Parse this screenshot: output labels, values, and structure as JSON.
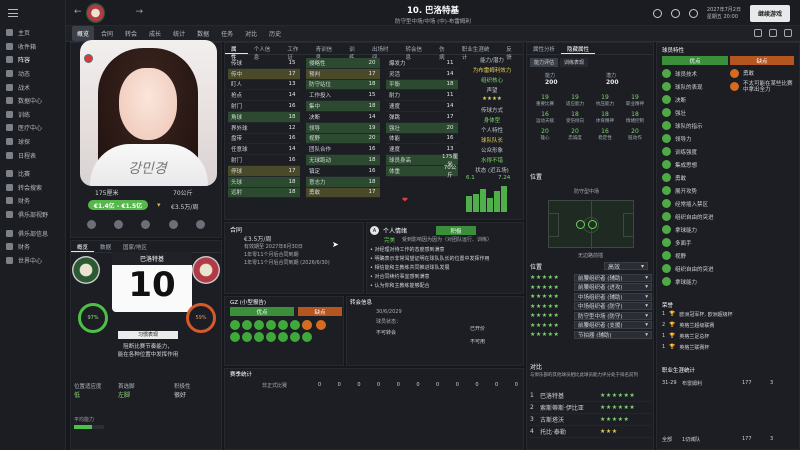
{
  "sidebar": {
    "items": [
      {
        "label": "主页",
        "active": false
      },
      {
        "label": "收件箱",
        "active": false
      },
      {
        "label": "阵容",
        "active": true
      },
      {
        "label": "动态",
        "active": false
      },
      {
        "label": "战术",
        "active": false
      },
      {
        "label": "数据中心",
        "active": false
      },
      {
        "label": "训练",
        "active": false
      },
      {
        "label": "医疗中心",
        "active": false
      },
      {
        "label": "球探",
        "active": false
      },
      {
        "label": "日程表",
        "active": false
      },
      {
        "label": "比赛",
        "active": false
      },
      {
        "label": "转会搜索",
        "active": false
      },
      {
        "label": "财务",
        "active": false
      },
      {
        "label": "俱乐部视野",
        "active": false
      },
      {
        "label": "俱乐部信息",
        "active": false
      },
      {
        "label": "财务",
        "active": false
      },
      {
        "label": "世界中心",
        "active": false
      }
    ]
  },
  "topbar": {
    "player_title": "10. 巴洛特基",
    "player_subtitle": "防守型中场/中场 (中)-布雷姆利",
    "nav": [
      "阵容",
      "合同",
      "球探",
      "发展",
      "数据",
      "训练",
      "对比",
      "历史"
    ],
    "date_line1": "2027年7月2日",
    "date_line2": "星期五 20:00",
    "continue_button": "继续游戏"
  },
  "tabs": [
    "概览",
    "合同",
    "转会",
    "成长",
    "统计",
    "数据",
    "任务",
    "对比",
    "历史"
  ],
  "profile": {
    "height": "175厘米",
    "weight": "70公斤",
    "value_range": "€1.4亿 - €1.5亿",
    "wage": "€3.5万/周",
    "photo_signature": "강민경"
  },
  "left_subtabs": [
    "概览",
    "数据",
    "国家/地区"
  ],
  "shirt": {
    "name": "巴洛特基",
    "number": "10"
  },
  "personality": {
    "label": "习惯表现",
    "desc_line1": "阻断比赛节奏能力，",
    "desc_line2": "能在各种位置中发挥作用",
    "stat_left": "97%",
    "stat_right": "59%"
  },
  "bottom_left": {
    "left_title": "位置适应度",
    "left_value": "低",
    "mid_title": "首选脚",
    "mid_value": "左脚",
    "right_title": "积极性",
    "right_value": "很好",
    "foot_note": "平均能力"
  },
  "attr_tabs": [
    "属性",
    "个人信息",
    "工作证",
    "青训信息",
    "训练",
    "出场时间",
    "转会信息",
    "伤病",
    "职业生涯统计",
    "反馈"
  ],
  "technical": {
    "title": "技术",
    "rows": [
      {
        "name": "传球",
        "value": "15"
      },
      {
        "name": "传中",
        "value": "17"
      },
      {
        "name": "盯人",
        "value": "13"
      },
      {
        "name": "抢点",
        "value": "14"
      },
      {
        "name": "射门",
        "value": "16"
      },
      {
        "name": "角球",
        "value": "18"
      },
      {
        "name": "界外球",
        "value": "12"
      },
      {
        "name": "盘带",
        "value": "16"
      },
      {
        "name": "任意球",
        "value": "14"
      },
      {
        "name": "射门",
        "value": "16"
      },
      {
        "name": "停球",
        "value": "17"
      },
      {
        "name": "头球",
        "value": "18"
      },
      {
        "name": "远射",
        "value": "18"
      }
    ]
  },
  "mental": {
    "title": "精神",
    "rows": [
      {
        "name": "侵略性",
        "value": "20"
      },
      {
        "name": "预判",
        "value": "17"
      },
      {
        "name": "防守站位",
        "value": "18"
      },
      {
        "name": "工作投入",
        "value": "15"
      },
      {
        "name": "集中",
        "value": "18"
      },
      {
        "name": "决断",
        "value": "14"
      },
      {
        "name": "领导",
        "value": "19"
      },
      {
        "name": "视野",
        "value": "20"
      },
      {
        "name": "团队合作",
        "value": "16"
      },
      {
        "name": "无球跑动",
        "value": "18"
      },
      {
        "name": "镇定",
        "value": "16"
      },
      {
        "name": "意志力",
        "value": "18"
      },
      {
        "name": "勇敢",
        "value": "17"
      }
    ]
  },
  "physical": {
    "title": "身体",
    "rows": [
      {
        "name": "爆发力",
        "value": "11"
      },
      {
        "name": "灵活",
        "value": "14"
      },
      {
        "name": "平衡",
        "value": "18"
      },
      {
        "name": "耐力",
        "value": "11"
      },
      {
        "name": "速度",
        "value": "14"
      },
      {
        "name": "弹跳",
        "value": "17"
      },
      {
        "name": "强壮",
        "value": "20"
      },
      {
        "name": "体能",
        "value": "16"
      },
      {
        "name": "速度",
        "value": "13"
      },
      {
        "name": "球员身高",
        "value": "175厘米"
      },
      {
        "name": "体重",
        "value": "70公斤"
      }
    ]
  },
  "roles_panel": {
    "title": "能力/潜力",
    "items": [
      {
        "label": "为布雷姆利效力",
        "cls": "y"
      },
      {
        "label": "组织核心",
        "cls": "g"
      },
      {
        "label": "声望",
        "cls": ""
      },
      {
        "label": "★★★★",
        "cls": "y"
      },
      {
        "label": "传球方式",
        "cls": ""
      },
      {
        "label": "身体型",
        "cls": "g"
      },
      {
        "label": "个人特性",
        "cls": ""
      },
      {
        "label": "球队队长",
        "cls": "y"
      },
      {
        "label": "公众形象",
        "cls": ""
      },
      {
        "label": "水得不错",
        "cls": "g"
      },
      {
        "label": "状态 (近五场)",
        "cls": ""
      }
    ]
  },
  "form": {
    "values": [
      6.1,
      7.24
    ]
  },
  "mini_bars": [
    0.6,
    0.7,
    0.9,
    0.55,
    0.8,
    1.0
  ],
  "contract": {
    "title": "合同",
    "wage": "€3.5万/周",
    "line1": "有效期至 2027年6月30日",
    "line2": "1年零11个月后合同到期",
    "line3": "1年零11个月后合同到期 (2026/6/30)"
  },
  "report": {
    "title": "个人情绪",
    "tag": "完美",
    "sub": "受到影响因为因为（对团队运行、训练）",
    "status": "积极",
    "lines": [
      "对经理对待工作的态度感到满意",
      "明确表示非常渴望证明在球队队长的位置中发挥作用",
      "相信能和主教练共同推进球队发展",
      "对合同续约事宜感到满意",
      "认为你和主教练能够配合"
    ]
  },
  "gz": {
    "title": "GZ (小型报告)",
    "good": "优点",
    "bad": "缺点"
  },
  "match_info": {
    "title": "转会信息",
    "date": "30/6/2029",
    "status1": "球员状态：",
    "val1": "不可转会",
    "status2": "已开价",
    "status3": "不可用"
  },
  "history": {
    "title": "赛季统计",
    "sub": "非正式比赛",
    "cols": [
      "0",
      "0",
      "0",
      "0",
      "0",
      "0",
      "0",
      "0",
      "0",
      "0",
      "0"
    ]
  },
  "right_tabs": [
    "属性分析",
    "隐藏属性"
  ],
  "right_subtabs": [
    "能力评估",
    "训练表现"
  ],
  "right_top": {
    "c1": "能力",
    "v1": "200",
    "c2": "潜力",
    "v2": "200"
  },
  "small_stats": [
    {
      "label": "19",
      "sub": "重要比赛"
    },
    {
      "label": "19",
      "sub": "适应能力"
    },
    {
      "label": "19",
      "sub": "抗压能力"
    },
    {
      "label": "19",
      "sub": "职业精神"
    },
    {
      "label": "16",
      "sub": "运动天赋"
    },
    {
      "label": "18",
      "sub": "受伤倾向"
    },
    {
      "label": "18",
      "sub": "体育精神"
    },
    {
      "label": "18",
      "sub": "情绪控制"
    },
    {
      "label": "20",
      "sub": "雄心"
    },
    {
      "label": "20",
      "sub": "忠诚度"
    },
    {
      "label": "16",
      "sub": "稳定性"
    },
    {
      "label": "20",
      "sub": "脏动作"
    }
  ],
  "position": {
    "title": "位置",
    "pos_label": "防守型中场",
    "note": "无边路前插"
  },
  "roles_list": {
    "title": "位置",
    "select": "高效",
    "rows": [
      {
        "stars": "★★★★★",
        "role": "前腰组织者 (辅助)",
        "star_cls": ""
      },
      {
        "stars": "★★★★★",
        "role": "前腰组织者 (进攻)",
        "star_cls": ""
      },
      {
        "stars": "★★★★★",
        "role": "中场组织者 (辅助)",
        "star_cls": ""
      },
      {
        "stars": "★★★★★",
        "role": "中场组织者 (防守)",
        "star_cls": ""
      },
      {
        "stars": "★★★★★",
        "role": "防守型中场 (防守)",
        "star_cls": ""
      },
      {
        "stars": "★★★★★",
        "role": "前腰组织者 (支援)",
        "star_cls": ""
      },
      {
        "stars": "★★★★★",
        "role": "节拍器 (辅助)",
        "star_cls": ""
      }
    ]
  },
  "ranking": {
    "title": "对比",
    "desc": "与俱乐部的其他球员相比此球员能力评分处于排名前列",
    "rows": [
      {
        "rank": "1",
        "name": "巴洛特基",
        "stars": "★★★★★★",
        "cls": ""
      },
      {
        "rank": "2",
        "name": "索斯蒂斯·伊比亚",
        "stars": "★★★★★★",
        "cls": ""
      },
      {
        "rank": "3",
        "name": "古斯塔沃",
        "stars": "★★★★★",
        "cls": ""
      },
      {
        "rank": "4",
        "name": "托比·泰勒",
        "stars": "★★★",
        "cls": "y"
      }
    ]
  },
  "traits": {
    "title": "球员特性",
    "good": "优点",
    "bad": "缺点",
    "bad_items": [
      "勇敢",
      "不太可能在某些比赛中拿出全力"
    ],
    "items": [
      "球员技术",
      "球队的表现",
      "决断",
      "强壮",
      "球队的指示",
      "领导力",
      "训练强度",
      "集成思想",
      "勇敢",
      "展开攻势",
      "经常插入禁区",
      "组织自由的突进",
      "拿球能力",
      "多面手",
      "视野",
      "组织自由的突进",
      "拿球能力"
    ]
  },
  "honours": {
    "title": "荣誉",
    "items": [
      {
        "n": "1",
        "t": "欧洲冠军杯, 欧洲超级杯"
      },
      {
        "n": "2",
        "t": "英格兰超级联赛"
      },
      {
        "n": "1",
        "t": "英格兰足总杯"
      },
      {
        "n": "1",
        "t": "英格兰联赛杯"
      }
    ]
  },
  "career": {
    "title": "职业生涯统计",
    "season": "31-29",
    "club": "布雷姆利",
    "apps": "177",
    "goals": "3",
    "total_label": "全部",
    "total_club": "1切城队",
    "total_apps": "177",
    "total_goals": "3"
  }
}
